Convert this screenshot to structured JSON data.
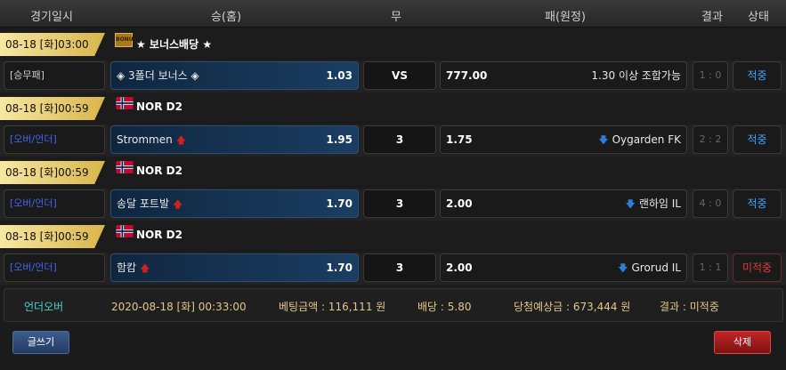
{
  "header": {
    "date": "경기일시",
    "home": "승(홈)",
    "draw": "무",
    "away": "패(원정)",
    "result": "결과",
    "status": "상태"
  },
  "rows": [
    {
      "datetime": "08-18 [화]03:00",
      "league": "★ 보너스배당 ★",
      "type": "[승무패]",
      "home": "◈ 3폴더 보너스 ◈",
      "home_odd": "1.03",
      "mid": "VS",
      "away_odd": "777.00",
      "away": "1.30 이상 조합가능",
      "score": "1 : 0",
      "status": "적중"
    },
    {
      "datetime": "08-18 [화]00:59",
      "league": "NOR D2",
      "type": "[오버/언더]",
      "home": "Strommen",
      "home_odd": "1.95",
      "mid": "3",
      "away_odd": "1.75",
      "away": "Oygarden FK",
      "score": "2 : 2",
      "status": "적중"
    },
    {
      "datetime": "08-18 [화]00:59",
      "league": "NOR D2",
      "type": "[오버/언더]",
      "home": "송달 포트발",
      "home_odd": "1.70",
      "mid": "3",
      "away_odd": "2.00",
      "away": "랜하임 IL",
      "score": "4 : 0",
      "status": "적중"
    },
    {
      "datetime": "08-18 [화]00:59",
      "league": "NOR D2",
      "type": "[오버/언더]",
      "home": "함캄",
      "home_odd": "1.70",
      "mid": "3",
      "away_odd": "2.00",
      "away": "Grorud IL",
      "score": "1 : 1",
      "status": "미적중"
    }
  ],
  "summary": {
    "kind": "언더오버",
    "date": "2020-08-18 [화] 00:33:00",
    "bet": "베팅금액 : 116,111 원",
    "odds": "배당 : 5.80",
    "expected": "당첨예상금 : 673,444 원",
    "result": "결과 : 미적중"
  },
  "buttons": {
    "write": "글쓰기",
    "delete": "삭제"
  },
  "bonus_icon": "BONUS",
  "colors": {
    "status_hit": "#39a7ff",
    "status_miss": "#e23b3b"
  }
}
